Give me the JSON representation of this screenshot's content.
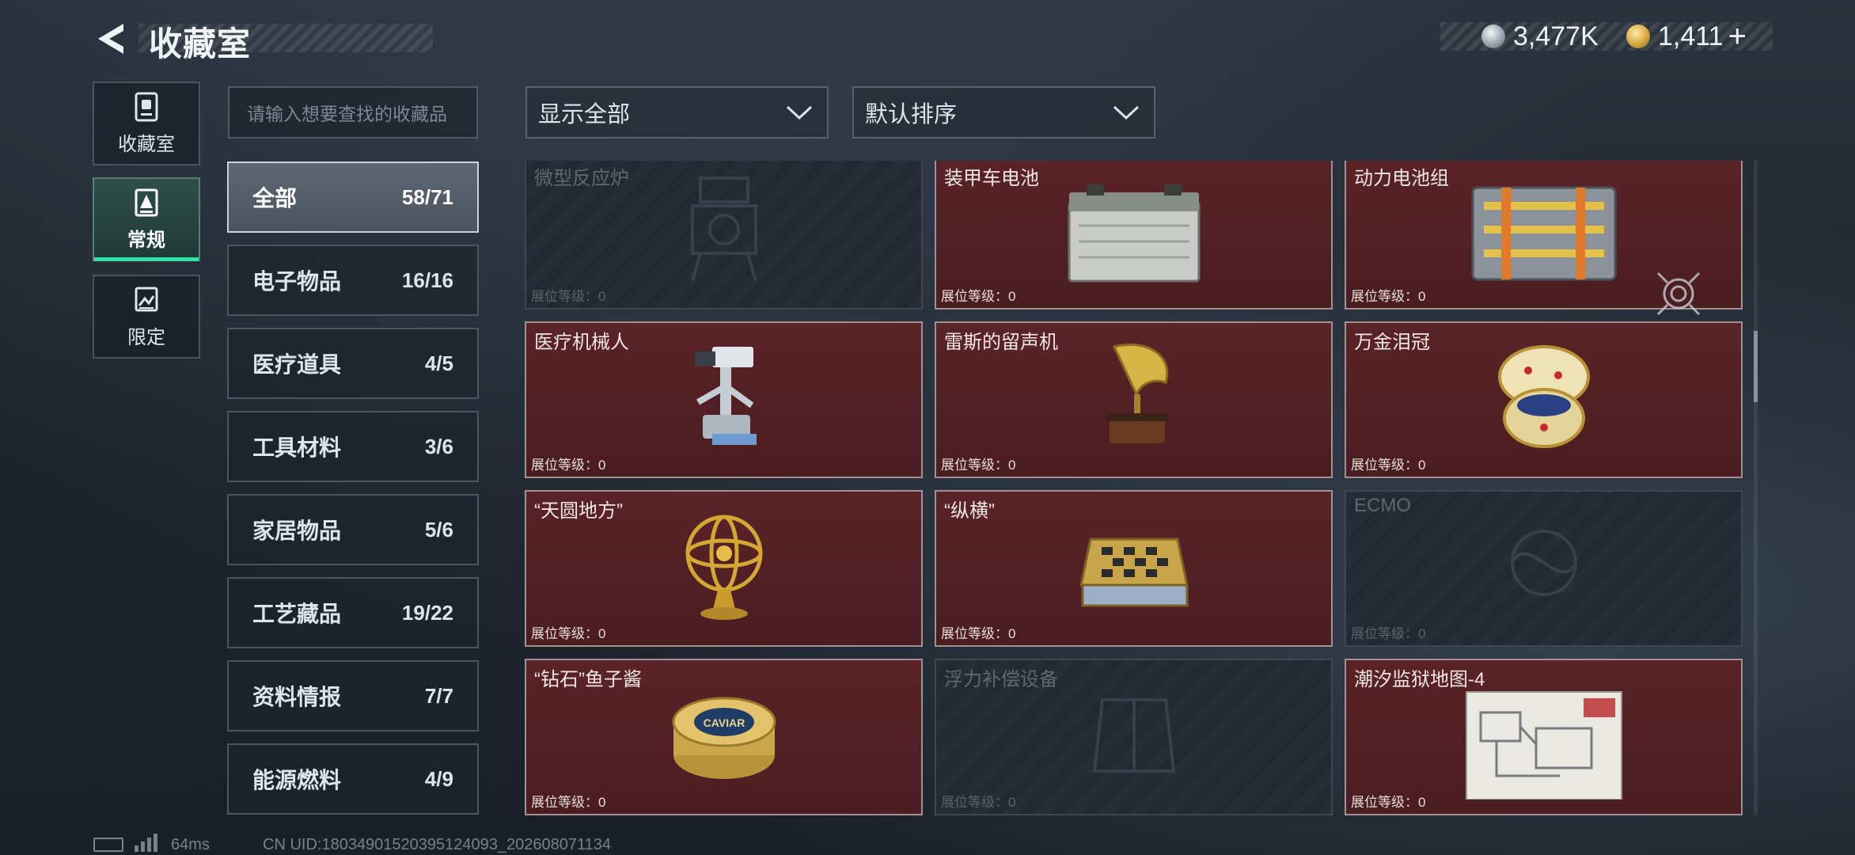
{
  "header": {
    "title": "收藏室"
  },
  "currency": [
    {
      "icon": "silver-coin-icon",
      "value": "3,477K"
    },
    {
      "icon": "gold-coin-icon",
      "value": "1,411"
    }
  ],
  "currency_plus": "+",
  "nav": [
    {
      "label": "收藏室",
      "icon": "collection-room-icon"
    },
    {
      "label": "常规",
      "icon": "regular-icon",
      "active": true
    },
    {
      "label": "限定",
      "icon": "limited-icon"
    }
  ],
  "search": {
    "placeholder": "请输入想要查找的收藏品"
  },
  "filters": {
    "show": "显示全部",
    "sort": "默认排序"
  },
  "categories": [
    {
      "name": "全部",
      "count": "58/71",
      "active": true
    },
    {
      "name": "电子物品",
      "count": "16/16"
    },
    {
      "name": "医疗道具",
      "count": "4/5"
    },
    {
      "name": "工具材料",
      "count": "3/6"
    },
    {
      "name": "家居物品",
      "count": "5/6"
    },
    {
      "name": "工艺藏品",
      "count": "19/22"
    },
    {
      "name": "资料情报",
      "count": "7/7"
    },
    {
      "name": "能源燃料",
      "count": "4/9"
    }
  ],
  "level_label": "展位等级：0",
  "items": [
    {
      "name": "微型反应炉",
      "locked": true,
      "icon": "reactor-icon"
    },
    {
      "name": "装甲车电池",
      "locked": false,
      "icon": "battery-icon"
    },
    {
      "name": "动力电池组",
      "locked": false,
      "icon": "battery-pack-icon"
    },
    {
      "name": "医疗机械人",
      "locked": false,
      "icon": "medical-robot-icon"
    },
    {
      "name": "雷斯的留声机",
      "locked": false,
      "icon": "gramophone-icon"
    },
    {
      "name": "万金泪冠",
      "locked": false,
      "icon": "jeweled-egg-icon"
    },
    {
      "name": "“天圆地方”",
      "locked": false,
      "icon": "armillary-sphere-icon"
    },
    {
      "name": "“纵横”",
      "locked": false,
      "icon": "chessboard-icon"
    },
    {
      "name": "ECMO",
      "locked": true,
      "icon": "ecmo-icon"
    },
    {
      "name": "“钻石”鱼子酱",
      "locked": false,
      "icon": "caviar-tin-icon",
      "art_text": "CAVIAR"
    },
    {
      "name": "浮力补偿设备",
      "locked": true,
      "icon": "bcd-icon"
    },
    {
      "name": "潮汐监狱地图-4",
      "locked": false,
      "icon": "map-icon"
    }
  ],
  "status": {
    "ping": "64ms",
    "uid": "CN UID:180349015203951​24093_202608071134"
  },
  "colors": {
    "accent": "#2fe0a0",
    "card_bg": "#4f1f23",
    "locked_bg": "#252c35"
  }
}
